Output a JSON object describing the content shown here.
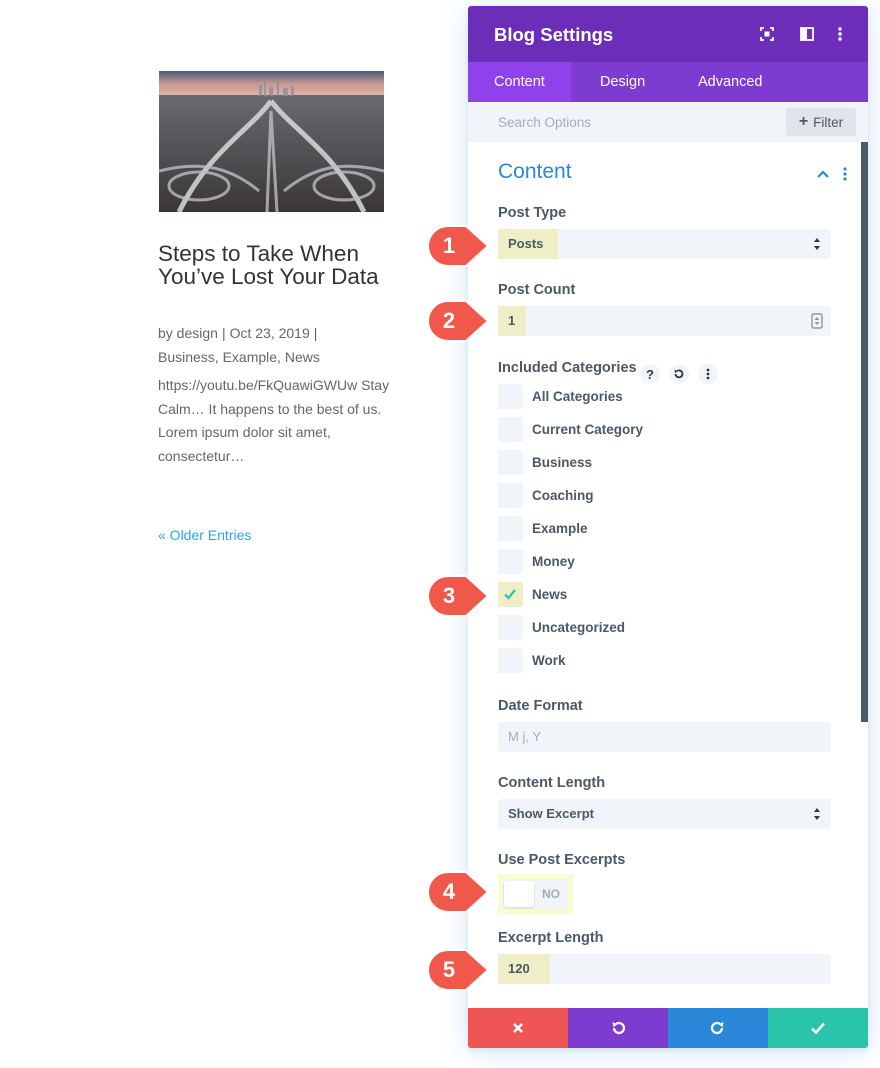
{
  "post": {
    "title": "Steps to Take When You’ve Lost Your Data",
    "meta_author_prefix": "by design",
    "meta_sep": "|",
    "meta_date": "Oct 23, 2019",
    "meta_categories": "Business, Example, News",
    "excerpt": "https://youtu.be/FkQuawiGWUw Stay Calm… It happens to the best of us. Lorem ipsum dolor sit amet, consectetur…",
    "older_entries": "« Older Entries"
  },
  "panel": {
    "title": "Blog Settings",
    "tabs": [
      "Content",
      "Design",
      "Advanced"
    ],
    "search_placeholder": "Search Options",
    "filter_label": "Filter",
    "section_title": "Content",
    "post_type": {
      "label": "Post Type",
      "value": "Posts"
    },
    "post_count": {
      "label": "Post Count",
      "value": "1"
    },
    "included_categories": {
      "label": "Included Categories",
      "help_icon": "?",
      "items": [
        {
          "label": "All Categories",
          "checked": false
        },
        {
          "label": "Current Category",
          "checked": false
        },
        {
          "label": "Business",
          "checked": false
        },
        {
          "label": "Coaching",
          "checked": false
        },
        {
          "label": "Example",
          "checked": false
        },
        {
          "label": "Money",
          "checked": false
        },
        {
          "label": "News",
          "checked": true
        },
        {
          "label": "Uncategorized",
          "checked": false
        },
        {
          "label": "Work",
          "checked": false
        }
      ]
    },
    "date_format": {
      "label": "Date Format",
      "placeholder": "M j, Y"
    },
    "content_length": {
      "label": "Content Length",
      "value": "Show Excerpt"
    },
    "use_post_excerpts": {
      "label": "Use Post Excerpts",
      "value": "NO"
    },
    "excerpt_length": {
      "label": "Excerpt Length",
      "value": "120"
    }
  },
  "callouts": [
    "1",
    "2",
    "3",
    "4",
    "5"
  ],
  "colors": {
    "header": "#6c2eb9",
    "tabs": "#7e3bd0",
    "active_tab": "#8f42ec",
    "accent_blue": "#2b87da",
    "highlight": "#efefc7",
    "callout_red": "#f0584b",
    "footer_cancel": "#ef5555",
    "footer_undo": "#7e3bd0",
    "footer_redo": "#2b87da",
    "footer_save": "#29c4a9"
  },
  "icons": {
    "header": [
      "expand-icon",
      "split-view-icon",
      "more-vertical-icon"
    ],
    "footer": [
      "close-icon",
      "undo-icon",
      "redo-icon",
      "check-icon"
    ]
  }
}
